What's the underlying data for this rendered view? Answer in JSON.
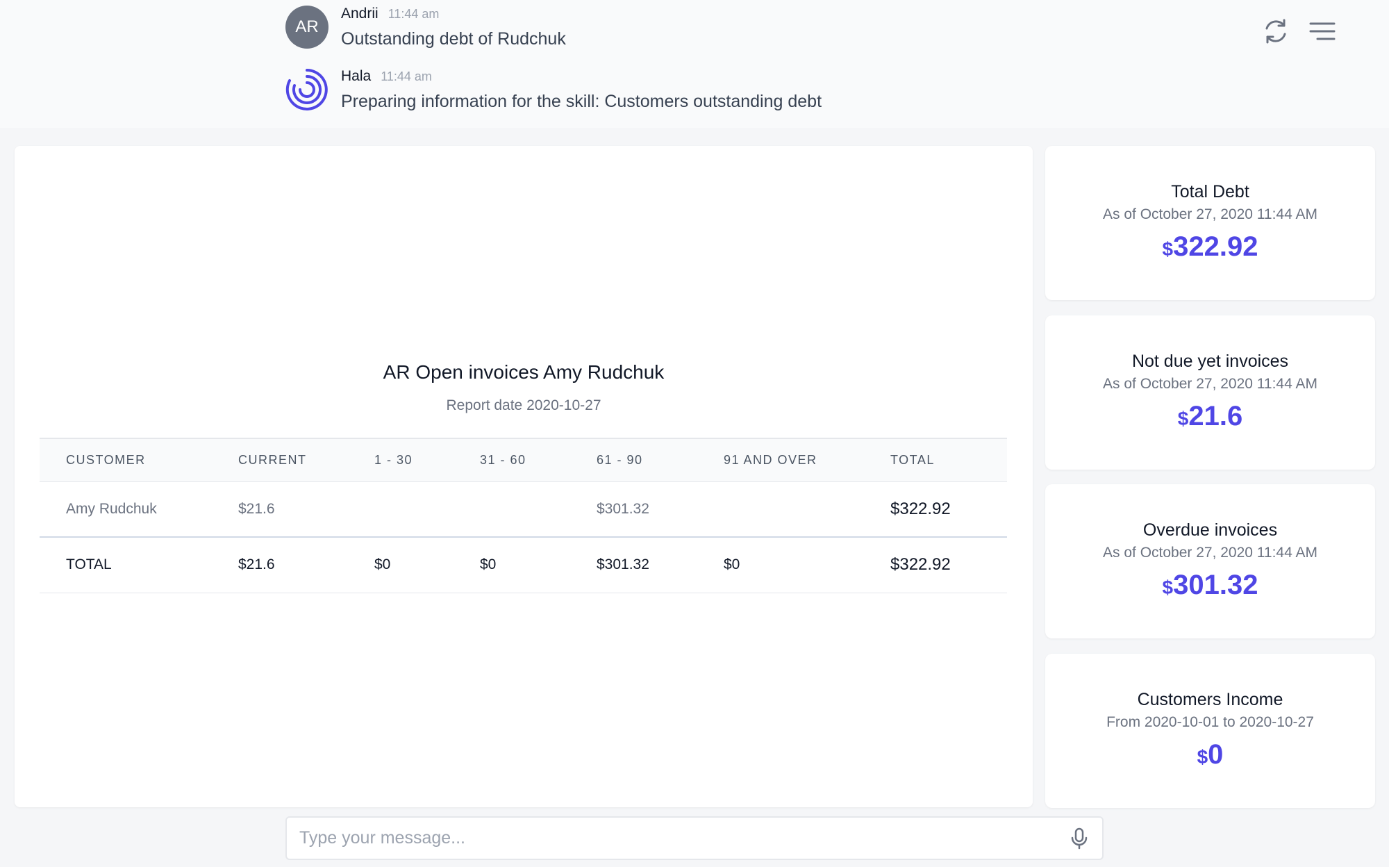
{
  "chat": {
    "messages": [
      {
        "avatar_initials": "AR",
        "author": "Andrii",
        "time": "11:44 am",
        "text": "Outstanding debt of Rudchuk"
      },
      {
        "avatar_icon": "hala-logo-icon",
        "author": "Hala",
        "time": "11:44 am",
        "text": "Preparing information for the skill: Customers outstanding debt"
      }
    ],
    "header_icons": [
      "refresh-icon",
      "menu-icon"
    ]
  },
  "report": {
    "title": "AR Open invoices Amy Rudchuk",
    "subtitle": "Report date 2020-10-27",
    "columns": [
      "CUSTOMER",
      "CURRENT",
      "1 - 30",
      "31 - 60",
      "61 - 90",
      "91 AND OVER",
      "TOTAL"
    ],
    "rows": [
      [
        "Amy Rudchuk",
        "$21.6",
        "",
        "",
        "$301.32",
        "",
        "$322.92"
      ]
    ],
    "totals": [
      "TOTAL",
      "$21.6",
      "$0",
      "$0",
      "$301.32",
      "$0",
      "$322.92"
    ]
  },
  "stats": [
    {
      "title": "Total Debt",
      "subtitle": "As of October 27, 2020 11:44 AM",
      "currency": "$",
      "value": "322.92"
    },
    {
      "title": "Not due yet invoices",
      "subtitle": "As of October 27, 2020 11:44 AM",
      "currency": "$",
      "value": "21.6"
    },
    {
      "title": "Overdue invoices",
      "subtitle": "As of October 27, 2020 11:44 AM",
      "currency": "$",
      "value": "301.32"
    },
    {
      "title": "Customers Income",
      "subtitle": "From 2020-10-01 to 2020-10-27",
      "currency": "$",
      "value": "0"
    }
  ],
  "composer": {
    "placeholder": "Type your message...",
    "icon": "microphone-icon"
  },
  "colors": {
    "accent": "#4f46e5",
    "avatar_bg": "#6b7280",
    "page_bg": "#f5f6f8"
  }
}
